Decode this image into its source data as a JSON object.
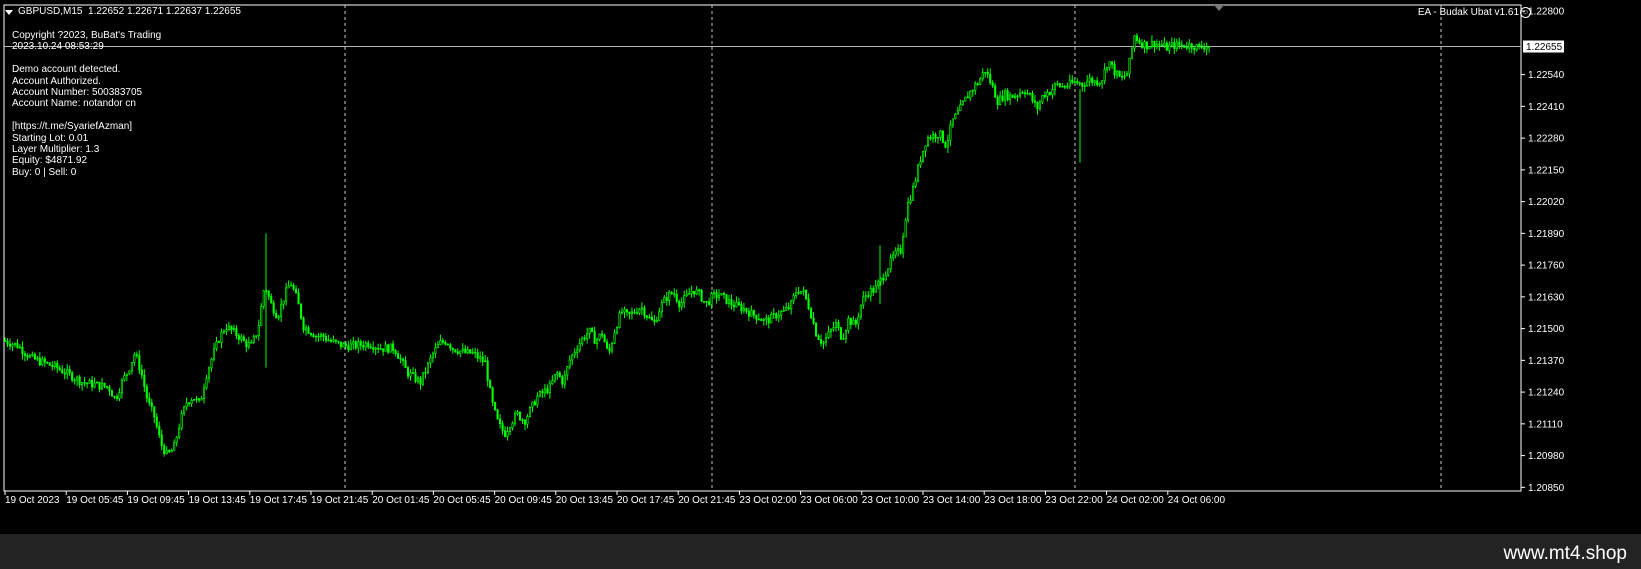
{
  "chart_window": {
    "symbol": "GBPUSD,M15",
    "ohlc": "1.22652 1.22671 1.22637 1.22655",
    "ea_label": "EA - Budak Ubat v1.61",
    "info_lines": [
      "Copyright ?2023, BuBat's Trading",
      "2023.10.24 08:53:29",
      "",
      "Demo account detected.",
      "Account Authorized.",
      "Account Number: 500383705",
      "Account Name: notandor cn",
      "",
      "[https://t.me/SyariefAzman]",
      "Starting Lot: 0.01",
      "Layer Multiplier: 1.3",
      "Equity: $4871.92",
      "Buy: 0 | Sell: 0"
    ],
    "current_price": "1.22655",
    "colors": {
      "background": "#000000",
      "candle": "#00ff00",
      "text": "#ffffff",
      "grid": "#c8c8c8",
      "footer": "#232323"
    }
  },
  "watermark": "www.mt4.shop",
  "chart_data": {
    "type": "candlestick",
    "price_ticks": [
      "1.22800",
      "1.22540",
      "1.22410",
      "1.22280",
      "1.22150",
      "1.22020",
      "1.21890",
      "1.21760",
      "1.21630",
      "1.21500",
      "1.21370",
      "1.21240",
      "1.21110",
      "1.20980",
      "1.20850"
    ],
    "time_labels": [
      "19 Oct 2023",
      "19 Oct 05:45",
      "19 Oct 09:45",
      "19 Oct 13:45",
      "19 Oct 17:45",
      "19 Oct 21:45",
      "20 Oct 01:45",
      "20 Oct 05:45",
      "20 Oct 09:45",
      "20 Oct 13:45",
      "20 Oct 17:45",
      "20 Oct 21:45",
      "23 Oct 02:00",
      "23 Oct 06:00",
      "23 Oct 10:00",
      "23 Oct 14:00",
      "23 Oct 18:00",
      "23 Oct 22:00",
      "24 Oct 02:00",
      "24 Oct 06:00"
    ],
    "period_separators": [
      "19 Oct 21:45",
      "20 Oct 21:45",
      "23 Oct 22:00",
      "24 Oct 22:00"
    ],
    "ylim": [
      1.20835,
      1.22825
    ],
    "current_price": 1.22655,
    "close_path": [
      [
        0,
        1.2145
      ],
      [
        12,
        1.2143
      ],
      [
        24,
        1.2138
      ],
      [
        36,
        1.2136
      ],
      [
        48,
        1.2134
      ],
      [
        60,
        1.2131
      ],
      [
        72,
        1.2128
      ],
      [
        84,
        1.2127
      ],
      [
        96,
        1.2126
      ],
      [
        102,
        1.2121
      ],
      [
        108,
        1.2128
      ],
      [
        114,
        1.2133
      ],
      [
        120,
        1.214
      ],
      [
        126,
        1.2132
      ],
      [
        132,
        1.212
      ],
      [
        138,
        1.2114
      ],
      [
        144,
        1.2103
      ],
      [
        150,
        1.2098
      ],
      [
        156,
        1.2101
      ],
      [
        162,
        1.2112
      ],
      [
        168,
        1.212
      ],
      [
        174,
        1.2122
      ],
      [
        180,
        1.2119
      ],
      [
        186,
        1.2131
      ],
      [
        192,
        1.2139
      ],
      [
        198,
        1.2146
      ],
      [
        204,
        1.2151
      ],
      [
        210,
        1.2149
      ],
      [
        216,
        1.2147
      ],
      [
        222,
        1.2144
      ],
      [
        228,
        1.2143
      ],
      [
        234,
        1.215
      ],
      [
        240,
        1.2168
      ],
      [
        246,
        1.216
      ],
      [
        252,
        1.2155
      ],
      [
        258,
        1.2163
      ],
      [
        264,
        1.2169
      ],
      [
        270,
        1.2162
      ],
      [
        276,
        1.2151
      ],
      [
        282,
        1.2149
      ],
      [
        288,
        1.2147
      ],
      [
        294,
        1.2147
      ],
      [
        300,
        1.2145
      ],
      [
        312,
        1.2143
      ],
      [
        324,
        1.2143
      ],
      [
        336,
        1.2144
      ],
      [
        348,
        1.2142
      ],
      [
        360,
        1.2142
      ],
      [
        366,
        1.2137
      ],
      [
        372,
        1.2132
      ],
      [
        378,
        1.213
      ],
      [
        384,
        1.2128
      ],
      [
        390,
        1.2134
      ],
      [
        396,
        1.214
      ],
      [
        402,
        1.2144
      ],
      [
        408,
        1.2145
      ],
      [
        414,
        1.2142
      ],
      [
        420,
        1.2141
      ],
      [
        426,
        1.214
      ],
      [
        432,
        1.214
      ],
      [
        438,
        1.2138
      ],
      [
        444,
        1.2136
      ],
      [
        450,
        1.212
      ],
      [
        456,
        1.2111
      ],
      [
        462,
        1.2107
      ],
      [
        468,
        1.2112
      ],
      [
        474,
        1.2115
      ],
      [
        480,
        1.2112
      ],
      [
        486,
        1.2117
      ],
      [
        492,
        1.2122
      ],
      [
        498,
        1.2124
      ],
      [
        504,
        1.2126
      ],
      [
        510,
        1.2132
      ],
      [
        516,
        1.2128
      ],
      [
        522,
        1.2137
      ],
      [
        528,
        1.2142
      ],
      [
        534,
        1.2146
      ],
      [
        540,
        1.2149
      ],
      [
        546,
        1.2145
      ],
      [
        552,
        1.2148
      ],
      [
        558,
        1.2139
      ],
      [
        564,
        1.215
      ],
      [
        570,
        1.2157
      ],
      [
        576,
        1.2155
      ],
      [
        582,
        1.2157
      ],
      [
        588,
        1.2159
      ],
      [
        594,
        1.2155
      ],
      [
        600,
        1.2152
      ],
      [
        606,
        1.2159
      ],
      [
        612,
        1.2163
      ],
      [
        618,
        1.2165
      ],
      [
        624,
        1.216
      ],
      [
        630,
        1.2163
      ],
      [
        636,
        1.2166
      ],
      [
        642,
        1.2164
      ],
      [
        648,
        1.216
      ],
      [
        654,
        1.2163
      ],
      [
        660,
        1.2164
      ],
      [
        666,
        1.2162
      ],
      [
        672,
        1.216
      ],
      [
        678,
        1.2159
      ],
      [
        684,
        1.2158
      ],
      [
        690,
        1.2156
      ],
      [
        696,
        1.2155
      ],
      [
        702,
        1.2153
      ],
      [
        708,
        1.2154
      ],
      [
        714,
        1.2156
      ],
      [
        720,
        1.2157
      ],
      [
        726,
        1.2159
      ],
      [
        732,
        1.2166
      ],
      [
        738,
        1.2165
      ],
      [
        744,
        1.2158
      ],
      [
        750,
        1.2148
      ],
      [
        756,
        1.2144
      ],
      [
        762,
        1.2148
      ],
      [
        768,
        1.2152
      ],
      [
        774,
        1.2146
      ],
      [
        780,
        1.2154
      ],
      [
        786,
        1.2151
      ],
      [
        792,
        1.2161
      ],
      [
        798,
        1.2165
      ],
      [
        804,
        1.2166
      ],
      [
        810,
        1.217
      ],
      [
        816,
        1.2175
      ],
      [
        822,
        1.218
      ],
      [
        828,
        1.2182
      ],
      [
        834,
        1.22
      ],
      [
        840,
        1.2208
      ],
      [
        846,
        1.2219
      ],
      [
        852,
        1.2228
      ],
      [
        858,
        1.2229
      ],
      [
        864,
        1.223
      ],
      [
        870,
        1.2225
      ],
      [
        876,
        1.2235
      ],
      [
        882,
        1.2239
      ],
      [
        888,
        1.2244
      ],
      [
        894,
        1.2248
      ],
      [
        900,
        1.2251
      ],
      [
        906,
        1.2256
      ],
      [
        912,
        1.225
      ],
      [
        918,
        1.2243
      ],
      [
        924,
        1.2246
      ],
      [
        930,
        1.2245
      ],
      [
        936,
        1.2246
      ],
      [
        942,
        1.2248
      ],
      [
        948,
        1.2245
      ],
      [
        954,
        1.224
      ],
      [
        960,
        1.2246
      ],
      [
        966,
        1.2247
      ],
      [
        972,
        1.225
      ],
      [
        978,
        1.2249
      ],
      [
        984,
        1.225
      ],
      [
        990,
        1.2251
      ],
      [
        996,
        1.225
      ],
      [
        1002,
        1.2252
      ],
      [
        1008,
        1.2251
      ],
      [
        1014,
        1.2252
      ],
      [
        1020,
        1.226
      ],
      [
        1026,
        1.2255
      ],
      [
        1032,
        1.2252
      ],
      [
        1038,
        1.2255
      ],
      [
        1044,
        1.227
      ],
      [
        1050,
        1.2267
      ],
      [
        1056,
        1.2266
      ],
      [
        1062,
        1.2267
      ],
      [
        1068,
        1.2266
      ],
      [
        1074,
        1.2265
      ],
      [
        1080,
        1.2266
      ],
      [
        1086,
        1.2266
      ],
      [
        1092,
        1.2266
      ],
      [
        1098,
        1.2266
      ],
      [
        1104,
        1.2265
      ],
      [
        1110,
        1.2266
      ],
      [
        1114,
        1.22655
      ]
    ],
    "x_span": 1114
  }
}
